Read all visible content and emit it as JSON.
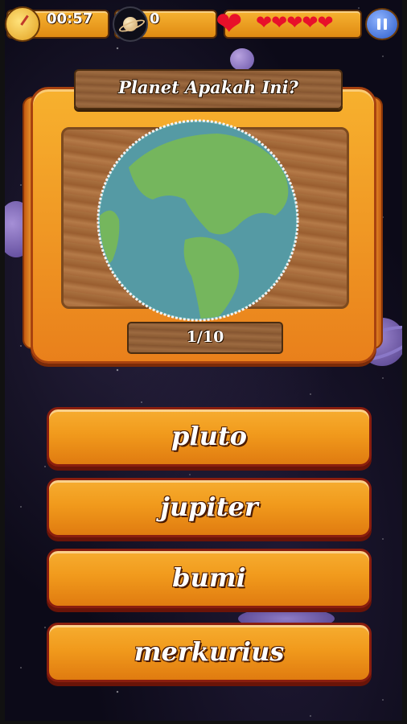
{
  "hud": {
    "timer": "00:57",
    "score": "0",
    "lives": 5,
    "icons": [
      "stopwatch-icon",
      "saturn-icon",
      "heart-icon",
      "pause-icon"
    ]
  },
  "question": {
    "title": "Planet Apakah Ini?",
    "progress": "1/10",
    "image": "earth-globe"
  },
  "answers": [
    "pluto",
    "jupiter",
    "bumi",
    "merkurius"
  ],
  "colors": {
    "button_orange": "#f19a1c",
    "button_border": "#8a1e0e",
    "heart_red": "#e8102a",
    "pause_blue": "#2a5ac8",
    "ocean": "#5fa8b0",
    "land": "#7cc063"
  }
}
